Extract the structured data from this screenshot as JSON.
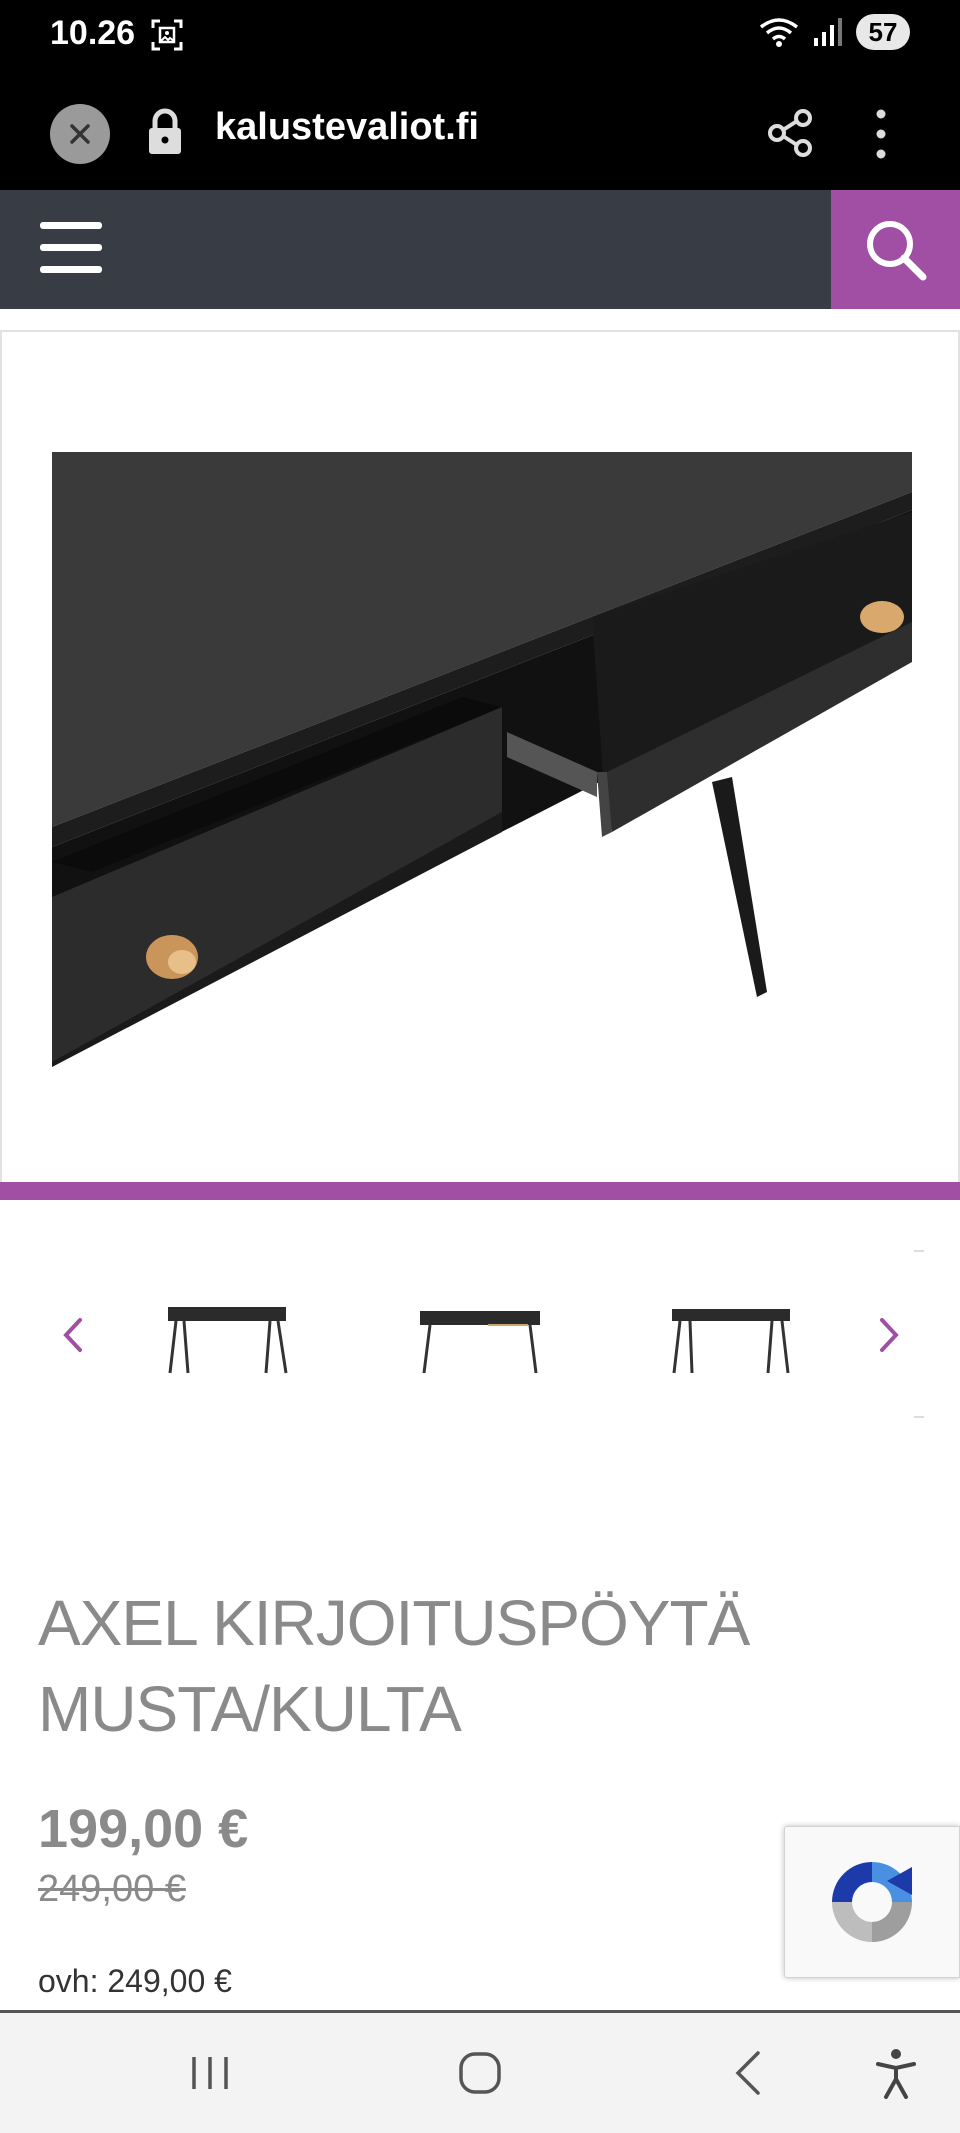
{
  "status_bar": {
    "time": "10.26",
    "battery": "57",
    "icons": [
      "screenshot-icon",
      "wifi-icon",
      "signal-icon"
    ]
  },
  "browser": {
    "url": "kalustevaliot.fi",
    "icons": [
      "close-icon",
      "lock-icon",
      "share-icon",
      "more-vert-icon"
    ]
  },
  "site_header": {
    "icons": [
      "hamburger-menu-icon",
      "search-icon"
    ],
    "accent_color": "#a04fa4",
    "background_color": "#383c44"
  },
  "product": {
    "title_line1": "AXEL KIRJOITUSPÖYTÄ",
    "title_line2": "MUSTA/KULTA",
    "price": "199,00 €",
    "old_price": "249,00 €",
    "ovh": "ovh: 249,00 €"
  },
  "carousel": {
    "icons": [
      "chevron-left-icon",
      "chevron-right-icon"
    ],
    "thumbnail_count": 3
  },
  "bottom_nav": {
    "icons": [
      "recents-icon",
      "home-icon",
      "back-icon",
      "accessibility-icon"
    ]
  }
}
